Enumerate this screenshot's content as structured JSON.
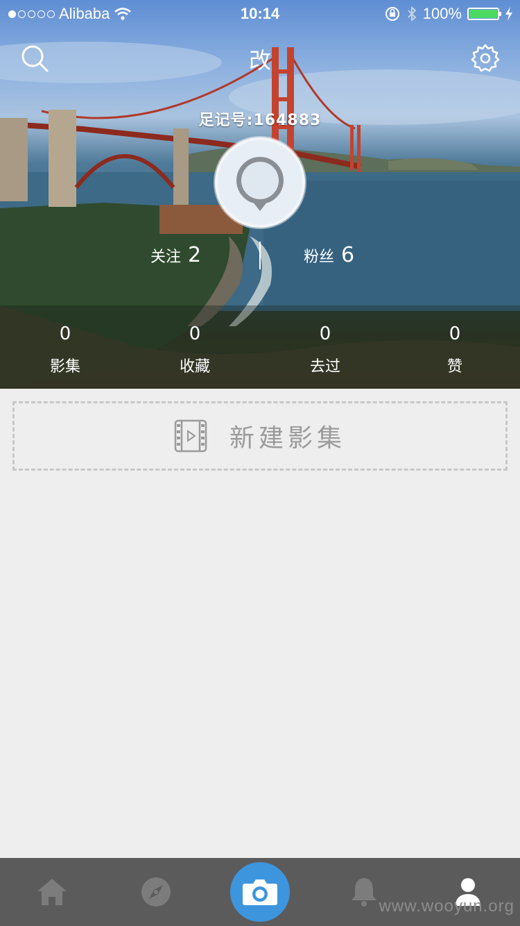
{
  "status_bar": {
    "carrier": "Alibaba",
    "time": "10:14",
    "battery": "100%",
    "signal_dots_filled": 1,
    "signal_dots_total": 5
  },
  "header": {
    "title": "改",
    "user_id": "足记号:164883"
  },
  "social": {
    "following_label": "关注",
    "following_count": "2",
    "followers_label": "粉丝",
    "followers_count": "6"
  },
  "stats": [
    {
      "value": "0",
      "label": "影集"
    },
    {
      "value": "0",
      "label": "收藏"
    },
    {
      "value": "0",
      "label": "去过"
    },
    {
      "value": "0",
      "label": "赞"
    }
  ],
  "new_album": {
    "label": "新建影集"
  },
  "tabbar": {
    "tabs": [
      "home-icon",
      "compass-icon",
      "camera-icon",
      "bell-icon",
      "profile-icon"
    ],
    "active": "profile-icon",
    "accent_color": "#3d95de"
  },
  "watermark": "www.wooyun.org"
}
